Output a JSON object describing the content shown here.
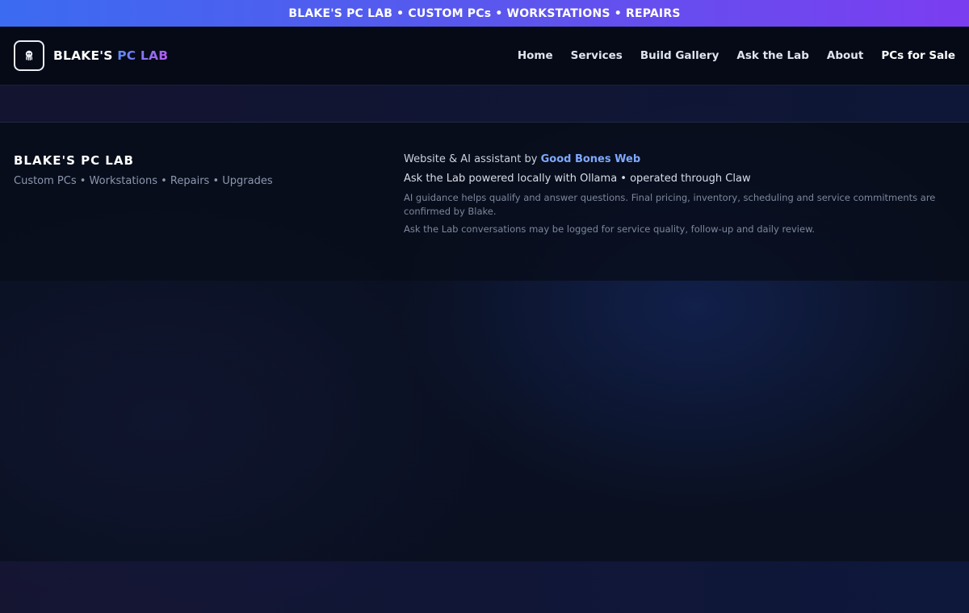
{
  "promo": {
    "text": "BLAKE'S PC LAB • CUSTOM PCs • WORKSTATIONS • REPAIRS"
  },
  "header": {
    "logo_icon": "robot-octopus-icon",
    "brand_main": "BLAKE'S ",
    "brand_accent": "PC LAB",
    "accent_gradient": [
      "#5b8cff",
      "#b45cf0"
    ]
  },
  "nav": {
    "items": [
      {
        "label": "Home"
      },
      {
        "label": "Services"
      },
      {
        "label": "Build Gallery"
      },
      {
        "label": "Ask the Lab"
      },
      {
        "label": "About"
      },
      {
        "label": "PCs for Sale"
      }
    ]
  },
  "footer": {
    "title": "BLAKE'S PC LAB",
    "tagline": "Custom PCs • Workstations • Repairs • Upgrades",
    "credit_prefix": "Website & AI assistant by ",
    "credit_link": "Good Bones Web",
    "powered": "Ask the Lab powered locally with Ollama • operated through Claw",
    "disclaimer": "AI guidance helps qualify and answer questions. Final pricing, inventory, scheduling and service commitments are confirmed by Blake.",
    "logging_note": "Ask the Lab conversations may be logged for service quality, follow-up and daily review."
  },
  "colors": {
    "promo_gradient": [
      "#3b6bf0",
      "#7b3df0"
    ],
    "link": "#7fa8ff",
    "background": "#0a0f1e"
  }
}
